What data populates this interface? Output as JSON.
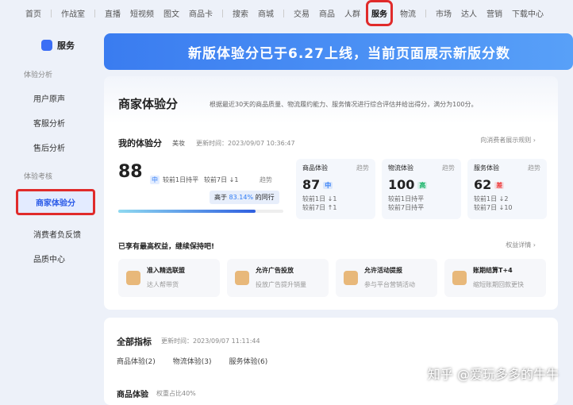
{
  "nav": [
    "首页",
    "作战室",
    "直播",
    "短视频",
    "图文",
    "商品卡",
    "搜索",
    "商城",
    "交易",
    "商品",
    "人群",
    "服务",
    "物流",
    "市场",
    "达人",
    "营销",
    "下载中心"
  ],
  "sidebar": {
    "title": "服务",
    "sections": [
      {
        "label": "体验分析",
        "items": [
          "用户原声",
          "客服分析",
          "售后分析"
        ]
      },
      {
        "label": "体验考核",
        "items": [
          "商家体验分",
          "消费者负反馈",
          "品质中心"
        ]
      }
    ]
  },
  "banner": "新版体验分已于6.27上线，当前页面展示新版分数",
  "main": {
    "title": "商家体验分",
    "desc": "根据最近30天的商品质量、物流履约能力、服务情况进行综合评估并给出得分，满分为100分。",
    "my": {
      "title": "我的体验分",
      "category": "美妆",
      "updated": "更新时间：2023/09/07 10:36:47",
      "score": "88",
      "level": "中",
      "d1": "较前1日持平",
      "d7": "较前7日 ↓1",
      "trend": "趋势",
      "beat_prefix": "高于",
      "beat_pct": "83.14%",
      "beat_suffix": "的同行",
      "percentile": 83.14,
      "rules": "向消费者展示规则 ›"
    },
    "subs": [
      {
        "name": "商品体验",
        "trend": "趋势",
        "score": "87",
        "level": "中",
        "color": "#2f7bf5",
        "d1": "较前1日 ↓1",
        "d7": "较前7日 ↑1"
      },
      {
        "name": "物流体验",
        "trend": "趋势",
        "score": "100",
        "level": "高",
        "color": "#1cb56b",
        "d1": "较前1日持平",
        "d7": "较前7日持平"
      },
      {
        "name": "服务体验",
        "trend": "趋势",
        "score": "62",
        "level": "差",
        "color": "#ee3b3b",
        "d1": "较前1日 ↓2",
        "d7": "较前7日 ↓10"
      }
    ],
    "perks_title": "已享有最高权益，继续保持吧!",
    "perks_link": "权益详情 ›",
    "perks": [
      {
        "t": "准入精选联盟",
        "s": "达人帮带货"
      },
      {
        "t": "允许广告投放",
        "s": "投放广告提升销量"
      },
      {
        "t": "允许活动提报",
        "s": "参与平台营销活动"
      },
      {
        "t": "账期结算T+4",
        "s": "缩短账期回款更快"
      }
    ]
  },
  "all": {
    "title": "全部指标",
    "updated": "更新时间：2023/09/07 11:11:44",
    "tabs": [
      "商品体验(2)",
      "物流体验(3)",
      "服务体验(6)"
    ],
    "sub": "商品体验",
    "weight": "权重占比40%"
  },
  "watermark": "知乎 @爱玩多多的牛牛"
}
